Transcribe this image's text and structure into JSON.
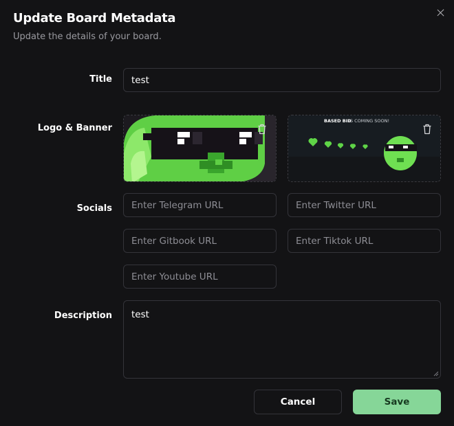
{
  "dialog": {
    "title": "Update Board Metadata",
    "subtitle": "Update the details of your board."
  },
  "fields": {
    "title_label": "Title",
    "title_value": "test",
    "logo_banner_label": "Logo & Banner",
    "socials_label": "Socials",
    "description_label": "Description",
    "description_value": "test"
  },
  "socials": {
    "telegram_placeholder": "Enter Telegram URL",
    "twitter_placeholder": "Enter Twitter URL",
    "gitbook_placeholder": "Enter Gitbook URL",
    "tiktok_placeholder": "Enter Tiktok URL",
    "youtube_placeholder": "Enter Youtube URL"
  },
  "banner": {
    "caption_bold": "BASED BID",
    "caption_rest": " IS COMING SOON!"
  },
  "buttons": {
    "cancel": "Cancel",
    "save": "Save"
  },
  "colors": {
    "background": "#131315",
    "border": "#34343a",
    "accent": "#86d698",
    "logo_green": "#7ee05a"
  },
  "icons": [
    "close-icon",
    "trash-icon",
    "resize-grip-icon"
  ]
}
